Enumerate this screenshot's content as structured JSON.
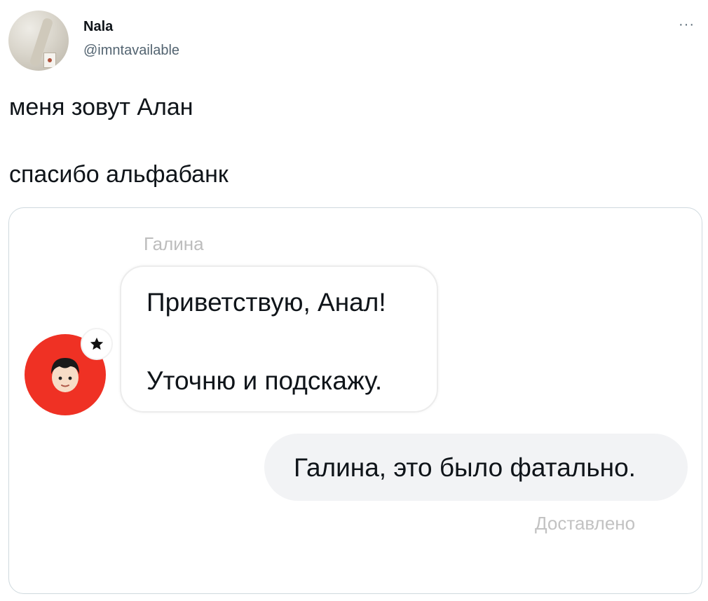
{
  "tweet": {
    "author": {
      "display_name": "Nala",
      "handle": "@imntavailable"
    },
    "more_label": "···",
    "text_lines": [
      "меня зовут Алан",
      "спасибо альфабанк"
    ]
  },
  "chat": {
    "sender_name": "Галина",
    "incoming_lines": [
      "Приветствую, Анал!",
      "Уточню и подскажу."
    ],
    "outgoing_message": "Галина, это было фатально.",
    "delivery_status": "Доставлено",
    "colors": {
      "bot_avatar_bg": "#ef3124",
      "outgoing_bubble_bg": "#f2f3f5"
    }
  },
  "icons": [
    "author-avatar",
    "more-options-icon",
    "bot-avatar",
    "star-icon"
  ]
}
